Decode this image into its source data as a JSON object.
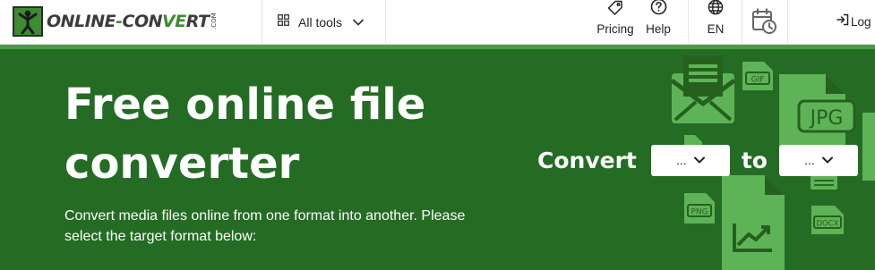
{
  "logo": {
    "text_main": "ONLINE",
    "text_dash": "-",
    "text_con": "CON",
    "text_ve": "VE",
    "text_rt": "RT",
    "text_com": ".COM"
  },
  "header": {
    "all_tools_label": "All tools",
    "pricing_label": "Pricing",
    "help_label": "Help",
    "language_label": "EN",
    "login_label": "Log"
  },
  "hero": {
    "title_line1": "Free online file",
    "title_line2": "converter",
    "subtitle_line1": "Convert media files online from one format into another. Please",
    "subtitle_line2": "select the target format below:",
    "convert_label": "Convert",
    "to_label": "to",
    "from_select_value": "...",
    "to_select_value": "...",
    "file_labels": {
      "gif": "GIF",
      "jpg": "JPG",
      "png": "PNG",
      "docx": "DOCX"
    }
  },
  "colors": {
    "hero_background": "#246b23",
    "accent": "#45a03c",
    "icon_light": "#5fb357",
    "icon_dark": "#24611f"
  },
  "icons": [
    "logo-icon",
    "grid-icon",
    "chevron-down-icon",
    "tag-icon",
    "help-circle-icon",
    "globe-icon",
    "calendar-clock-icon",
    "login-icon",
    "envelope-icon",
    "file-icon",
    "chart-icon"
  ]
}
